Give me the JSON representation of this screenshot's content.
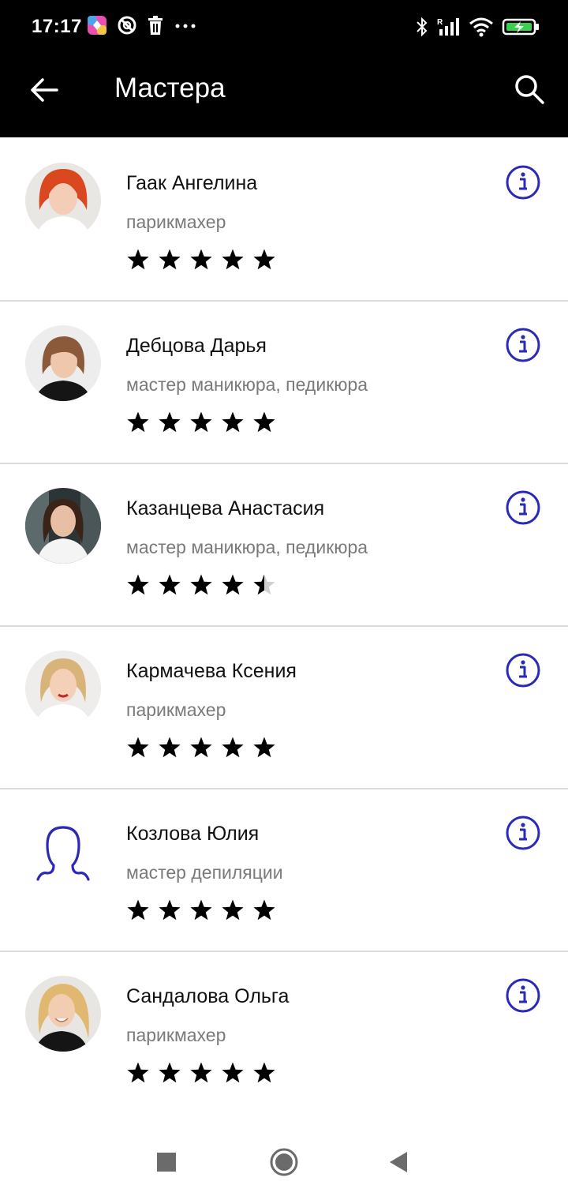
{
  "status_bar": {
    "time": "17:17",
    "left_icons": [
      "app-icon",
      "do-not-disturb-icon",
      "trash-icon",
      "more-dots-icon"
    ],
    "right_icons": [
      "bluetooth-icon",
      "signal-icon",
      "wifi-icon",
      "battery-charging-icon"
    ]
  },
  "app_bar": {
    "title": "Мастера",
    "back_icon": "arrow-left-icon",
    "search_icon": "search-icon"
  },
  "masters": [
    {
      "name": "Гаак Ангелина",
      "role": "парикмахер",
      "rating": 5,
      "avatar": "photo"
    },
    {
      "name": "Дебцова Дарья",
      "role": "мастер маникюра, педикюра",
      "rating": 5,
      "avatar": "photo"
    },
    {
      "name": "Казанцева Анастасия",
      "role": "мастер маникюра, педикюра",
      "rating": 4.5,
      "avatar": "photo"
    },
    {
      "name": "Кармачева Ксения",
      "role": "парикмахер",
      "rating": 5,
      "avatar": "photo"
    },
    {
      "name": "Козлова Юлия",
      "role": "мастер депиляции",
      "rating": 5,
      "avatar": "placeholder"
    },
    {
      "name": "Сандалова Ольга",
      "role": "парикмахер",
      "rating": 5,
      "avatar": "photo"
    }
  ],
  "colors": {
    "accent": "#2a2ab8",
    "app_bar": "#000000",
    "divider": "#dcdcdc",
    "role_text": "#7a7a7a"
  },
  "nav_bar": {
    "buttons": [
      "recents-square-icon",
      "home-circle-icon",
      "back-triangle-icon"
    ]
  }
}
